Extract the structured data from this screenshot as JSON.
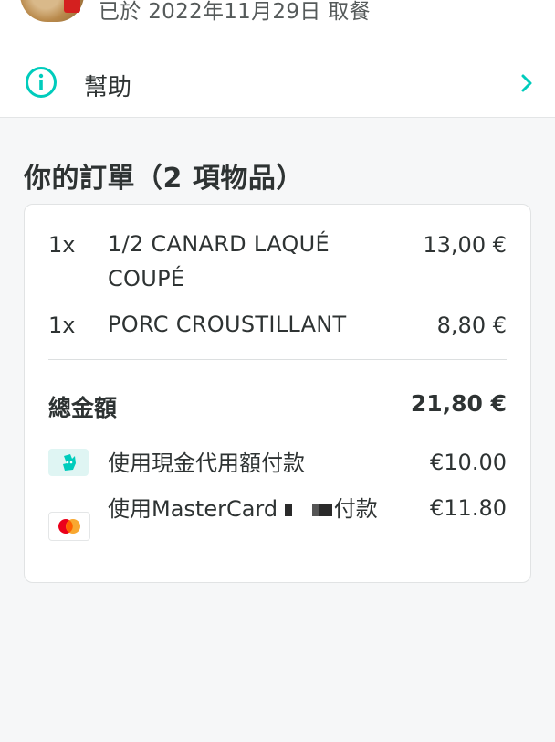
{
  "header": {
    "pickup_status": "已於 2022年11月29日 取餐"
  },
  "help": {
    "label": "幫助"
  },
  "order": {
    "title": "你的訂單（2 項物品）",
    "items": [
      {
        "qty": "1x",
        "name": "1/2 CANARD LAQUÉ COUPÉ",
        "price": "13,00 €"
      },
      {
        "qty": "1x",
        "name": "PORC CROUSTILLANT",
        "price": "8,80 €"
      }
    ],
    "total_label": "總金額",
    "total_value": "21,80 €",
    "payments": [
      {
        "text": "使用現金代用額付款",
        "amount": "€10.00",
        "icon": "deliveroo-credit-icon"
      },
      {
        "text_before": "使用MasterCard",
        "text_after": "付款",
        "amount": "€11.80",
        "icon": "mastercard-icon"
      }
    ]
  },
  "colors": {
    "accent": "#00ccbc",
    "text": "#2e3333",
    "background": "#f6f7f8"
  }
}
